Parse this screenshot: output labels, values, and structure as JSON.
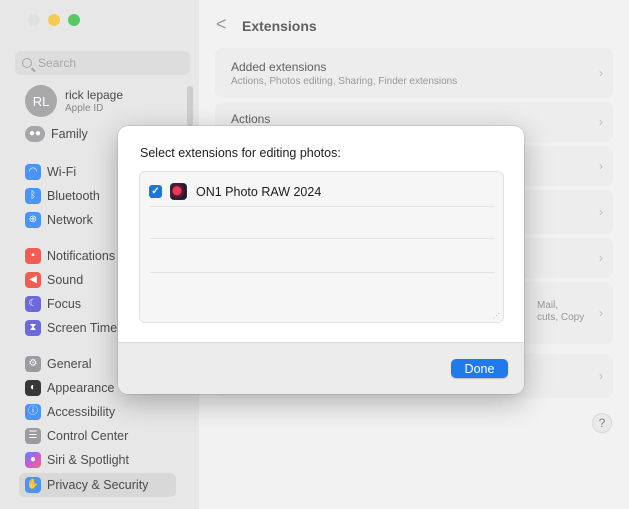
{
  "window": {
    "traffic_lights": [
      "close",
      "minimize",
      "maximize"
    ]
  },
  "sidebar": {
    "search_placeholder": "Search",
    "account": {
      "initials": "RL",
      "name": "rick lepage",
      "subtitle": "Apple ID"
    },
    "family_label": "Family",
    "items": [
      {
        "label": "Wi-Fi",
        "icon": "wifi-icon",
        "color": "#2f86f6"
      },
      {
        "label": "Bluetooth",
        "icon": "bluetooth-icon",
        "color": "#2f86f6"
      },
      {
        "label": "Network",
        "icon": "globe-icon",
        "color": "#2f86f6"
      },
      {
        "label": "Notifications",
        "icon": "bell-icon",
        "color": "#f0473c"
      },
      {
        "label": "Sound",
        "icon": "speaker-icon",
        "color": "#f0473c"
      },
      {
        "label": "Focus",
        "icon": "moon-icon",
        "color": "#5b55d6"
      },
      {
        "label": "Screen Time",
        "icon": "hourglass-icon",
        "color": "#5b55d6"
      },
      {
        "label": "General",
        "icon": "gear-icon",
        "color": "#8e8e93"
      },
      {
        "label": "Appearance",
        "icon": "appearance-icon",
        "color": "#1c1c1e"
      },
      {
        "label": "Accessibility",
        "icon": "accessibility-icon",
        "color": "#2f86f6"
      },
      {
        "label": "Control Center",
        "icon": "control-center-icon",
        "color": "#8e8e93"
      },
      {
        "label": "Siri & Spotlight",
        "icon": "siri-icon",
        "color": "#c143d8"
      },
      {
        "label": "Privacy & Security",
        "icon": "hand-icon",
        "color": "#2f86f6"
      }
    ]
  },
  "main": {
    "title": "Extensions",
    "back_glyph": "<",
    "rows": [
      {
        "title": "Added extensions",
        "subtitle": "Actions, Photos editing, Sharing, Finder extensions"
      },
      {
        "title": "Actions",
        "subtitle": ""
      }
    ],
    "partial_text": [
      "Mail,",
      "cuts, Copy"
    ],
    "help_label": "?"
  },
  "sheet": {
    "title": "Select extensions for editing photos:",
    "extensions": [
      {
        "name": "ON1 Photo RAW 2024",
        "checked": true
      }
    ],
    "done_label": "Done"
  },
  "colors": {
    "accent": "#1f7aeb",
    "checkbox": "#1a73e8"
  }
}
